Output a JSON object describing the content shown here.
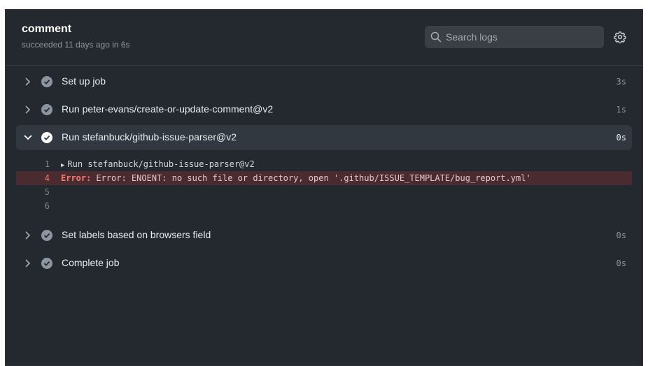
{
  "job": {
    "title": "comment",
    "status": "succeeded 11 days ago in 6s"
  },
  "search": {
    "placeholder": "Search logs"
  },
  "steps": [
    {
      "name": "Set up job",
      "duration": "3s",
      "expanded": false,
      "icon": "check-circle-icon"
    },
    {
      "name": "Run peter-evans/create-or-update-comment@v2",
      "duration": "1s",
      "expanded": false,
      "icon": "check-circle-icon"
    },
    {
      "name": "Run stefanbuck/github-issue-parser@v2",
      "duration": "0s",
      "expanded": true,
      "icon": "check-circle-icon"
    },
    {
      "name": "Set labels based on browsers field",
      "duration": "0s",
      "expanded": false,
      "icon": "check-circle-icon"
    },
    {
      "name": "Complete job",
      "duration": "0s",
      "expanded": false,
      "icon": "check-circle-icon"
    }
  ],
  "log": [
    {
      "num": "1",
      "text": "Run stefanbuck/github-issue-parser@v2",
      "collapsible": true
    },
    {
      "num": "4",
      "label": "Error:",
      "text": "Error: ENOENT: no such file or directory, open '.github/ISSUE_TEMPLATE/bug_report.yml'",
      "error": true
    },
    {
      "num": "5",
      "text": ""
    },
    {
      "num": "6",
      "text": ""
    }
  ],
  "colors": {
    "background": "#24292f",
    "error_bg": "#4a2b30",
    "error_text": "#ff7b72"
  }
}
